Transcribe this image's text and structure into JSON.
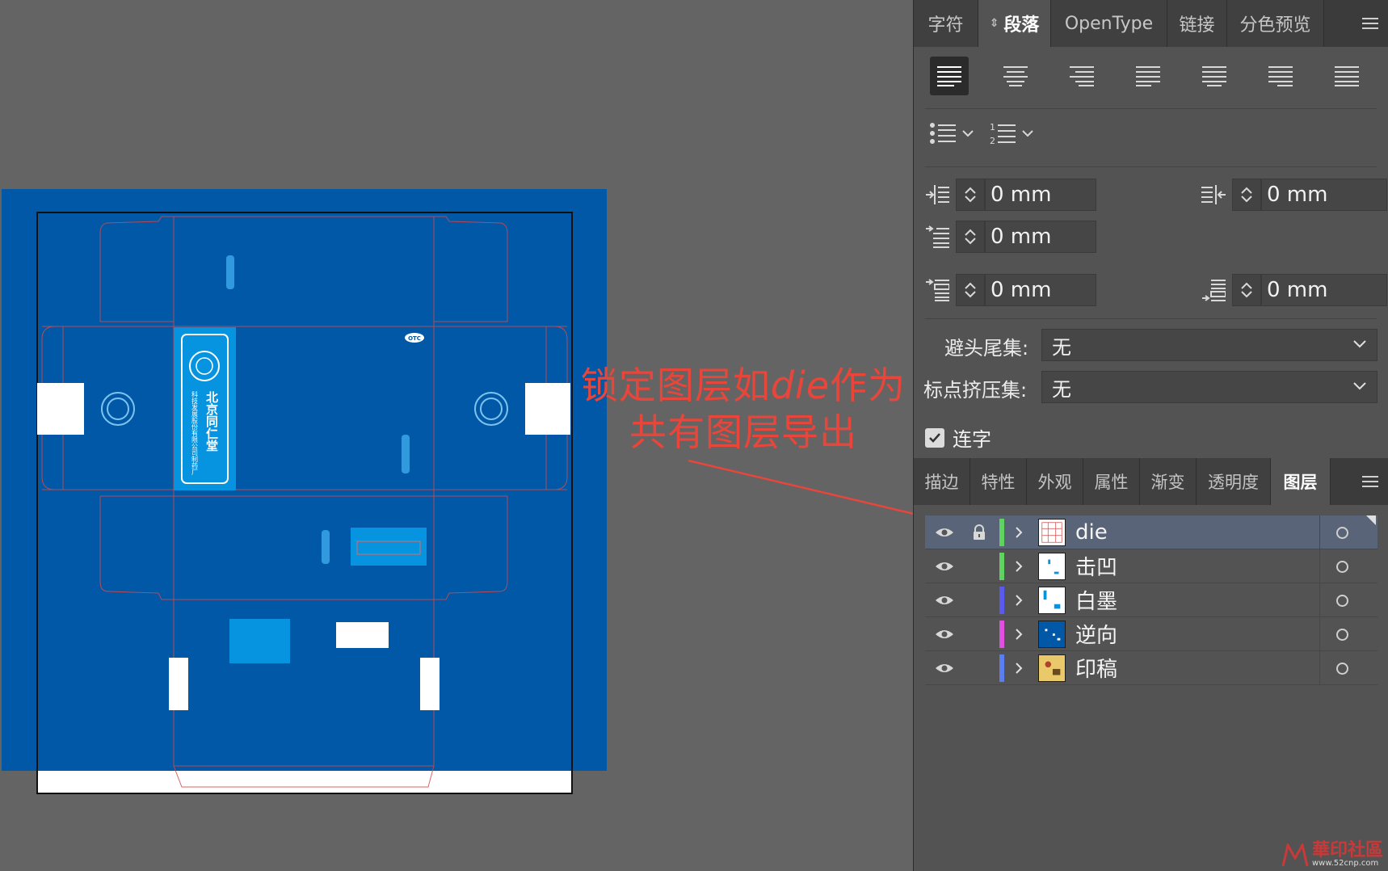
{
  "annotation": {
    "line1_pre": "锁定图层如",
    "line1_em": "die",
    "line1_post": "作为",
    "line2": "共有图层导出",
    "color": "#e8463a"
  },
  "artwork": {
    "brand_vertical": "北京同仁堂",
    "company_vertical": "科技发展股份有限公司制药厂",
    "badge": "OTC",
    "colors": {
      "bleed": "#0058a6",
      "accent": "#0693e0",
      "dieline": "#d24b4b"
    }
  },
  "top_panel": {
    "tabs": [
      {
        "label": "字符",
        "active": false
      },
      {
        "label": "段落",
        "active": true,
        "icon": "swap-arrows-icon"
      },
      {
        "label": "OpenType",
        "active": false
      },
      {
        "label": "链接",
        "active": false
      },
      {
        "label": "分色预览",
        "active": false
      }
    ],
    "alignment_buttons": [
      {
        "name": "align-left",
        "active": true
      },
      {
        "name": "align-center",
        "active": false
      },
      {
        "name": "align-right",
        "active": false
      },
      {
        "name": "justify-last-left",
        "active": false
      },
      {
        "name": "justify-last-center",
        "active": false
      },
      {
        "name": "justify-last-right",
        "active": false
      },
      {
        "name": "justify-all",
        "active": false
      }
    ],
    "fields": {
      "left_indent": "0 mm",
      "right_indent": "0 mm",
      "first_line_indent": "0 mm",
      "space_before": "0 mm",
      "space_after": "0 mm"
    },
    "kinsoku_label": "避头尾集:",
    "kinsoku_value": "无",
    "mojikumi_label": "标点挤压集:",
    "mojikumi_value": "无",
    "hyphenate_label": "连字",
    "hyphenate_checked": true
  },
  "bottom_panel": {
    "tabs": [
      {
        "label": "描边",
        "active": false
      },
      {
        "label": "特性",
        "active": false
      },
      {
        "label": "外观",
        "active": false
      },
      {
        "label": "属性",
        "active": false
      },
      {
        "label": "渐变",
        "active": false
      },
      {
        "label": "透明度",
        "active": false
      },
      {
        "label": "图层",
        "active": true
      }
    ],
    "layers": [
      {
        "name": "die",
        "color": "#5fd35f",
        "locked": true,
        "selected": true,
        "thumb": "die"
      },
      {
        "name": "击凹",
        "color": "#5fd35f",
        "locked": false,
        "selected": false,
        "thumb": "emboss"
      },
      {
        "name": "白墨",
        "color": "#5a5af0",
        "locked": false,
        "selected": false,
        "thumb": "white"
      },
      {
        "name": "逆向",
        "color": "#e04fe0",
        "locked": false,
        "selected": false,
        "thumb": "reverse"
      },
      {
        "name": "印稿",
        "color": "#5a7ef0",
        "locked": false,
        "selected": false,
        "thumb": "print"
      }
    ]
  },
  "watermark": {
    "text": "華印社區",
    "url": "www.52cnp.com"
  }
}
